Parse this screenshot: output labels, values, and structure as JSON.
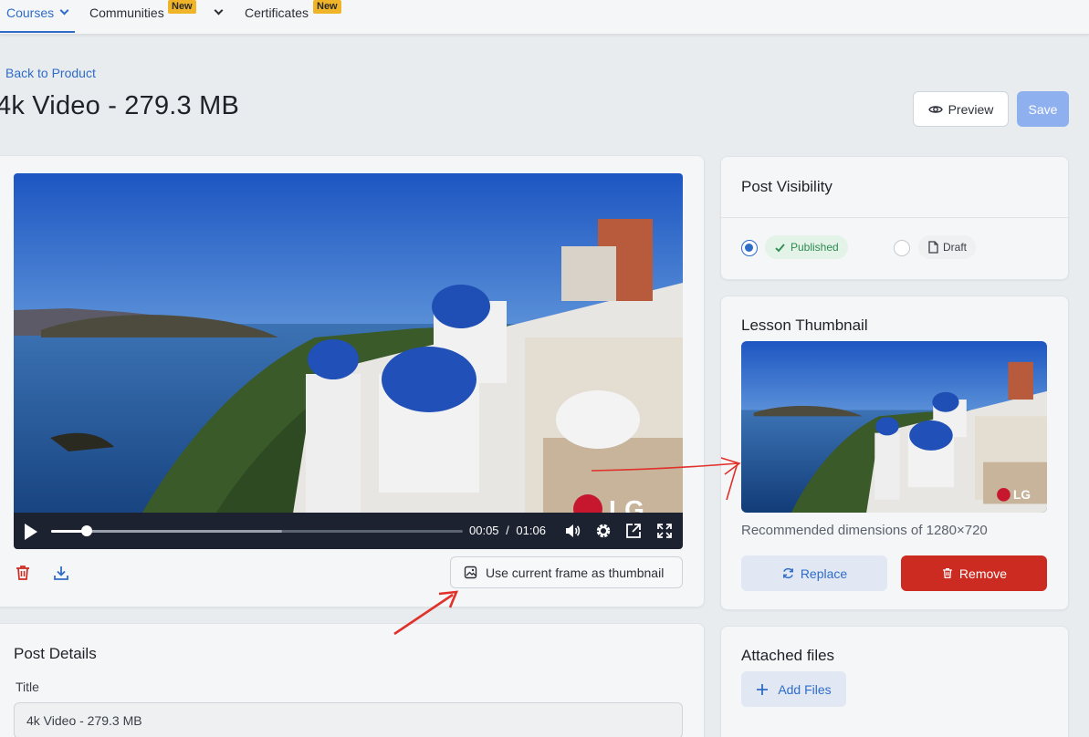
{
  "nav": {
    "courses": "Courses",
    "communities": "Communities",
    "certificates": "Certificates",
    "new_badge": "New"
  },
  "back_link": "Back to Product",
  "page_title": "4k Video - 279.3 MB",
  "actions": {
    "preview": "Preview",
    "save": "Save"
  },
  "player": {
    "current_time": "00:05",
    "separator": "/",
    "duration": "01:06",
    "progress_fraction": 0.086,
    "buffered_fraction": 0.56,
    "watermark": "LG"
  },
  "video_actions": {
    "use_frame": "Use current frame as thumbnail"
  },
  "post_details": {
    "heading": "Post Details",
    "title_label": "Title",
    "title_value": "4k Video - 279.3 MB"
  },
  "visibility": {
    "heading": "Post Visibility",
    "published": "Published",
    "draft": "Draft",
    "selected": "published"
  },
  "thumbnail": {
    "heading": "Lesson Thumbnail",
    "recommended": "Recommended dimensions of 1280×720",
    "replace": "Replace",
    "remove": "Remove",
    "watermark": "LG"
  },
  "attached": {
    "heading": "Attached files",
    "add": "Add Files"
  },
  "colors": {
    "accent": "#2f6cc8",
    "danger": "#cc2b22",
    "success": "#2e8b52",
    "badge": "#f0b429",
    "annotation": "#e0312b"
  }
}
